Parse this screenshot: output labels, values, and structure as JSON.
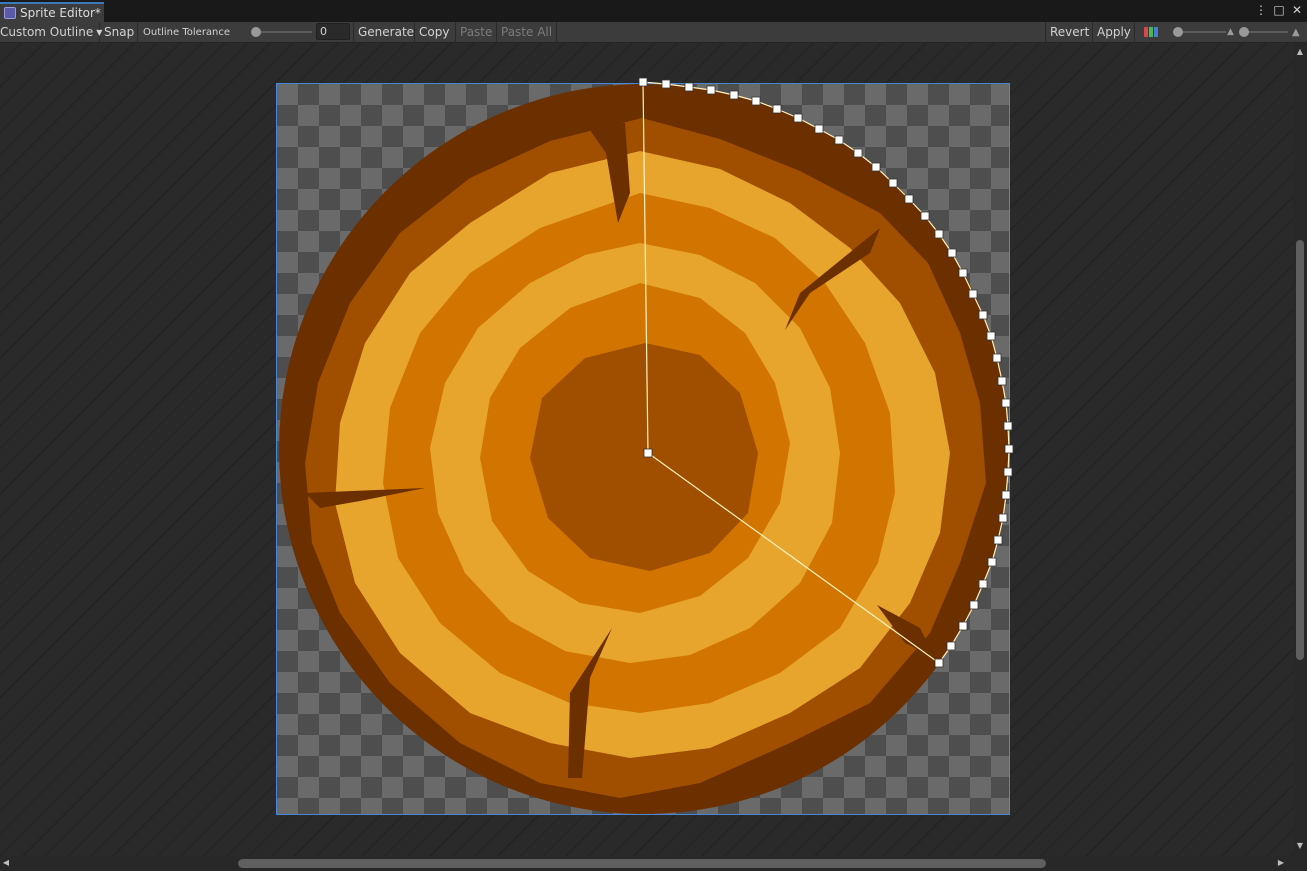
{
  "window": {
    "tab_title": "Sprite Editor*",
    "tab_icon": "sprite-editor-icon"
  },
  "toolbar": {
    "mode_dropdown": "Custom Outline",
    "snap": "Snap",
    "outline_tolerance_label": "Outline Tolerance",
    "outline_tolerance_value": "0",
    "outline_tolerance_slider": 0,
    "generate": "Generate",
    "copy": "Copy",
    "paste": "Paste",
    "paste_all": "Paste All",
    "revert": "Revert",
    "apply": "Apply"
  },
  "colors": {
    "selection_border": "#4a86d8",
    "wood_dark": "#6b2f00",
    "wood_mid": "#a04e00",
    "wood_orange": "#d27500",
    "wood_light": "#e8a52e"
  }
}
